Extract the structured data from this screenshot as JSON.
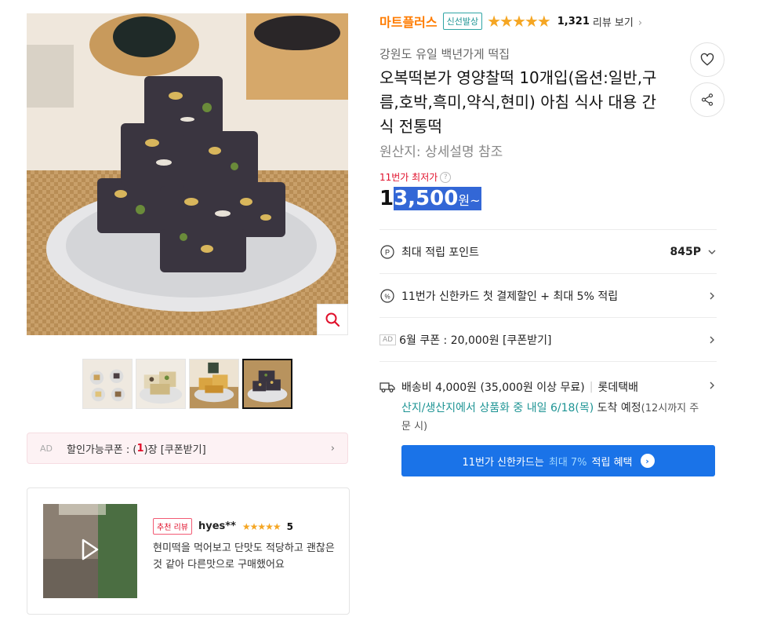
{
  "gallery": {
    "main_image_alt": "",
    "thumbnail_count": 4,
    "active_thumbnail": 4
  },
  "coupon_bar": {
    "ad": "AD",
    "label_pre": "할인가능쿠폰 : (",
    "count": "1",
    "label_post": ")장 [쿠폰받기]",
    "chevron": "›"
  },
  "review": {
    "badge": "추천 리뷰",
    "user": "hyes**",
    "stars": "★★★★★",
    "score": "5",
    "text": "현미떡을 먹어보고 단맛도 적당하고 괜찮은것 같아 다른맛으로 구매했어요"
  },
  "seller": {
    "store_name": "마트플러스",
    "badge": "신선발상",
    "rating": 4.5,
    "rating_stars": "★★★★★",
    "review_count": "1,321",
    "review_link": "리뷰 보기",
    "chevron": "›"
  },
  "product": {
    "subtitle": "강원도 유일 백년가게 떡집",
    "title": "오복떡본가 영양찰떡 10개입(옵션:일반,구름,호박,흑미,약식,현미) 아침 식사 대용 간식 전통떡",
    "origin": "원산지:  상세설명 참조"
  },
  "price": {
    "lowest_label": "11번가 최저가",
    "help": "?",
    "digit_first": "1",
    "digits_rest": "3,500",
    "unit": "원~"
  },
  "rows": {
    "points_label": "최대 적립 포인트",
    "points_value": "845P",
    "card_discount": "11번가 신한카드 첫 결제할인 + 최대 5% 적립",
    "coupon_ad": "AD",
    "coupon": "6월 쿠폰 : 20,000원 [쿠폰받기]"
  },
  "shipping": {
    "fee": "배송비 4,000원 (35,000원 이상 무료)",
    "carrier": "롯데택배",
    "notice_teal": "산지/생산지에서 상품화 중 내일 6/18(목)",
    "notice_arrival": " 도착 예정",
    "notice_small": "(12시까지 주문 시)"
  },
  "banner": {
    "pre": "11번가 신한카드는 ",
    "emphasis": "최대 7%",
    "post": " 적립 혜택",
    "go": "›"
  },
  "icons": {
    "heart": "heart-icon",
    "share": "share-icon",
    "zoom": "magnifier-icon",
    "play": "play-icon"
  },
  "colors": {
    "store": "#ff7c00",
    "accent_red": "#e0102b",
    "teal": "#1e9494",
    "banner_blue": "#1a73e8",
    "star": "#f5a623",
    "highlight": "#3367d6"
  }
}
